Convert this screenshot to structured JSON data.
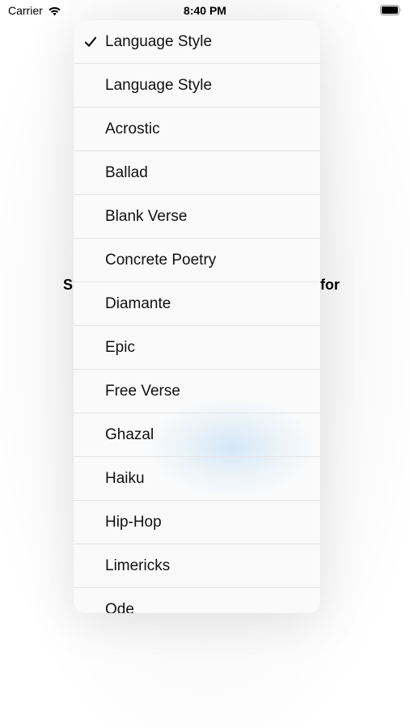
{
  "status_bar": {
    "carrier": "Carrier",
    "time": "8:40 PM",
    "wifi_icon": "wifi-icon",
    "battery_icon": "battery-icon"
  },
  "background": {
    "label_left_fragment": "S",
    "label_right_fragment": "for"
  },
  "menu": {
    "selected_index": 0,
    "check_icon": "checkmark-icon",
    "items": [
      {
        "label": "Language Style",
        "checked": true
      },
      {
        "label": "Language Style",
        "checked": false
      },
      {
        "label": "Acrostic",
        "checked": false
      },
      {
        "label": "Ballad",
        "checked": false
      },
      {
        "label": "Blank Verse",
        "checked": false
      },
      {
        "label": "Concrete Poetry",
        "checked": false
      },
      {
        "label": "Diamante",
        "checked": false
      },
      {
        "label": "Epic",
        "checked": false
      },
      {
        "label": "Free Verse",
        "checked": false
      },
      {
        "label": "Ghazal",
        "checked": false
      },
      {
        "label": "Haiku",
        "checked": false
      },
      {
        "label": "Hip-Hop",
        "checked": false
      },
      {
        "label": "Limericks",
        "checked": false
      },
      {
        "label": "Ode",
        "checked": false
      }
    ]
  }
}
